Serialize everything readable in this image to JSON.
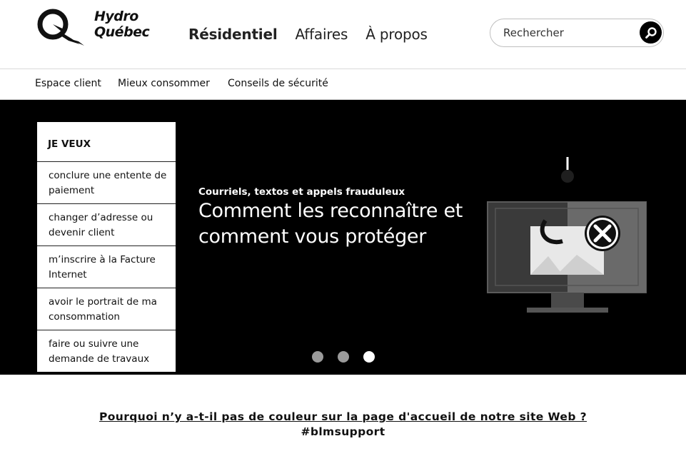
{
  "header": {
    "logo": {
      "line1": "Hydro",
      "line2": "Québec"
    },
    "nav": [
      {
        "label": "Résidentiel",
        "active": true
      },
      {
        "label": "Affaires",
        "active": false
      },
      {
        "label": "À propos",
        "active": false
      }
    ],
    "search": {
      "placeholder": "Rechercher",
      "icon": "search-icon"
    }
  },
  "subnav": [
    "Espace client",
    "Mieux consommer",
    "Conseils de sécurité"
  ],
  "jeveux": {
    "title": "JE VEUX",
    "items": [
      "conclure une entente de paiement",
      "changer d’adresse ou devenir client",
      "m’inscrire à la Facture Internet",
      "avoir le portrait de ma consommation",
      "faire ou suivre une demande de travaux"
    ]
  },
  "hero": {
    "kicker": "Courriels, textos et appels frauduleux",
    "title": "Comment les reconnaître et comment vous protéger",
    "illustration_icon": "phishing-monitor-icon",
    "slides": {
      "count": 3,
      "active_index": 2
    }
  },
  "footer": {
    "link": "Pourquoi n’y a-t-il pas de couleur sur la page d'accueil de notre site Web  ?",
    "tag": "#blmsupport"
  },
  "colors": {
    "hero_bg": "#000000",
    "dot_inactive": "#9a9a9a",
    "dot_active": "#ffffff"
  }
}
